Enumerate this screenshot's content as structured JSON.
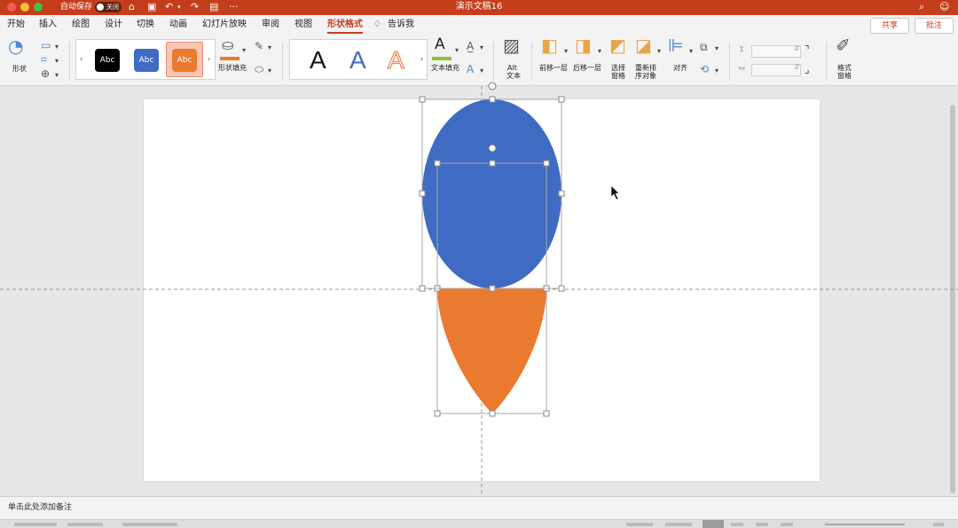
{
  "window": {
    "title": "演示文稿16",
    "autosave_label": "自动保存",
    "autosave_state": "关闭"
  },
  "tabs": [
    "开始",
    "插入",
    "绘图",
    "设计",
    "切换",
    "动画",
    "幻灯片放映",
    "审阅",
    "视图",
    "形状格式"
  ],
  "tell_me": "告诉我",
  "active_tab": "形状格式",
  "header_buttons": {
    "share": "共享",
    "comment": "批注"
  },
  "ribbon": {
    "shape_label": "形状",
    "style_swatches": [
      {
        "text": "Abc",
        "color": "#000000"
      },
      {
        "text": "Abc",
        "color": "#3f6cc2"
      },
      {
        "text": "Abc",
        "color": "#ea7a30"
      }
    ],
    "shape_fill_label": "形状填充",
    "wordart_letters": [
      {
        "text": "A",
        "color": "#111111"
      },
      {
        "text": "A",
        "color": "#3f6cc2"
      },
      {
        "text": "A",
        "color": "#f5a070"
      }
    ],
    "text_fill_label": "文本填充",
    "alt_text_label_1": "Alt",
    "alt_text_label_2": "文本",
    "bring_forward_label": "前移一层",
    "send_backward_label": "后移一层",
    "selection_pane_label_1": "选择",
    "selection_pane_label_2": "窗格",
    "reorder_label_1": "重新排",
    "reorder_label_2": "序对象",
    "align_label": "对齐",
    "format_pane_label_1": "格式",
    "format_pane_label_2": "窗格"
  },
  "slide": {
    "shapes": [
      {
        "kind": "drop",
        "color": "#ea7a30"
      },
      {
        "kind": "ellipse",
        "color": "#3f6cc2"
      }
    ]
  },
  "notes_placeholder": "单击此处添加备注",
  "colors": {
    "accent": "#c43e1c",
    "blue": "#3f6cc2",
    "orange": "#ea7a30"
  }
}
